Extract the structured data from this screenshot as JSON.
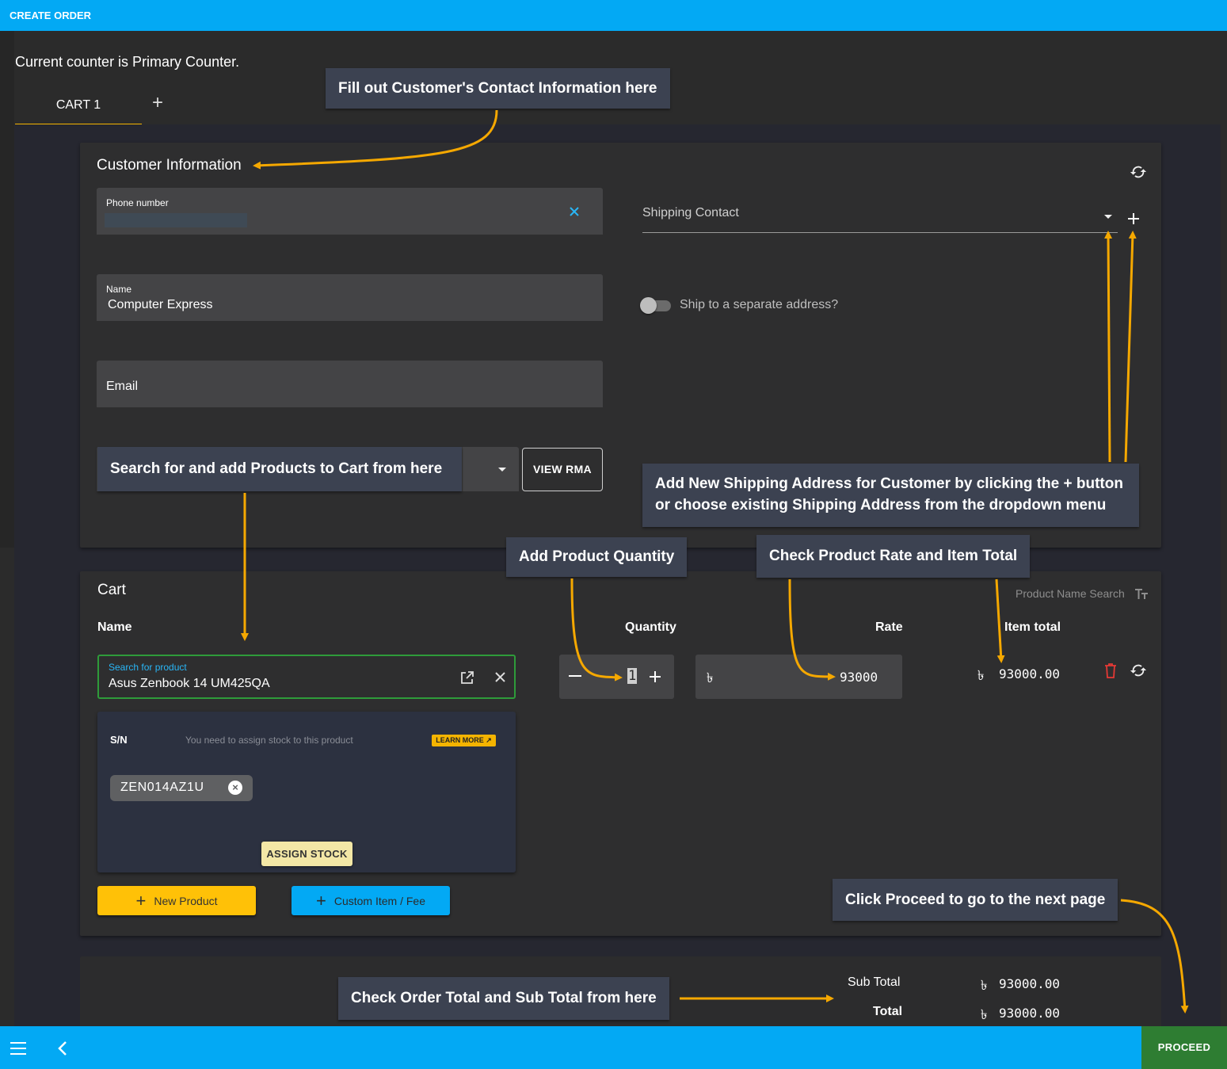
{
  "topbar": {
    "title": "CREATE ORDER"
  },
  "counter_text": "Current counter is Primary Counter.",
  "tabs": [
    {
      "label": "CART 1"
    }
  ],
  "customer": {
    "title": "Customer Information",
    "phone_label": "Phone number",
    "name_label": "Name",
    "name_value": "Computer Express",
    "email_label": "Email",
    "shipping_label": "Shipping Contact",
    "ship_toggle_label": "Ship to a separate address?",
    "view_rma_label": "VIEW RMA"
  },
  "cart": {
    "title": "Cart",
    "product_name_search_label": "Product Name Search",
    "columns": {
      "name": "Name",
      "quantity": "Quantity",
      "rate": "Rate",
      "item_total": "Item total"
    },
    "item": {
      "search_label": "Search for product",
      "product_name": "Asus Zenbook 14 UM425QA",
      "quantity": "1",
      "currency_symbol": "৳",
      "rate": "93000",
      "item_total": "93000.00"
    },
    "sn": {
      "label": "S/N",
      "hint": "You need to assign stock to this product",
      "learn_more": "LEARN MORE",
      "chip": "ZEN014AZ1U",
      "assign_stock": "ASSIGN STOCK"
    },
    "new_product_label": "New Product",
    "custom_item_label": "Custom Item / Fee"
  },
  "totals": {
    "sub_total_label": "Sub Total",
    "sub_total_value": "93000.00",
    "total_label": "Total",
    "total_value": "93000.00"
  },
  "bottombar": {
    "proceed_label": "PROCEED"
  },
  "annotations": {
    "contact": "Fill out Customer's Contact Information here",
    "search": "Search for and add Products to Cart from here",
    "shipping_line1": "Add New Shipping Address for Customer by clicking the + button",
    "shipping_line2": "or choose existing Shipping Address from the dropdown menu",
    "quantity": "Add Product Quantity",
    "rate": "Check Product Rate and Item Total",
    "proceed": "Click Proceed to go to the next page",
    "totals": "Check Order Total and Sub Total from here"
  },
  "colors": {
    "primary": "#03a9f4",
    "accent": "#f5b400",
    "proceed": "#2e7d32",
    "arrow": "#f5a800",
    "callout_bg": "#3c4251"
  },
  "icons": [
    "refresh-icon",
    "close-icon",
    "dropdown-arrow-icon",
    "plus-icon",
    "open-in-new-icon",
    "minus-icon",
    "delete-icon",
    "text-fields-icon",
    "menu-icon",
    "chevron-left-icon",
    "cancel-icon"
  ]
}
